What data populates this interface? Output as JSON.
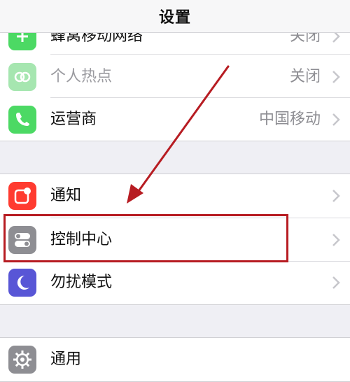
{
  "navbar": {
    "title": "设置"
  },
  "group1": {
    "rows": [
      {
        "label": "蜂窝移动网络",
        "value": "关闭",
        "icon": "cellular-icon",
        "icon_color": "#4cd964"
      },
      {
        "label": "个人热点",
        "value": "关闭",
        "icon": "hotspot-icon",
        "icon_color": "#a6e6b0"
      },
      {
        "label": "运营商",
        "value": "中国移动",
        "icon": "phone-icon",
        "icon_color": "#4cd964"
      }
    ]
  },
  "group2": {
    "rows": [
      {
        "label": "通知",
        "icon": "notifications-icon",
        "icon_color": "#ff3b30"
      },
      {
        "label": "控制中心",
        "icon": "control-center-icon",
        "icon_color": "#8e8e93"
      },
      {
        "label": "勿扰模式",
        "icon": "moon-icon",
        "icon_color": "#5856d6"
      }
    ]
  },
  "group3": {
    "rows": [
      {
        "label": "通用",
        "icon": "gear-icon",
        "icon_color": "#8e8e93"
      }
    ]
  },
  "annotation": {
    "arrow_color": "#b71c22",
    "box_color": "#b71c22"
  }
}
